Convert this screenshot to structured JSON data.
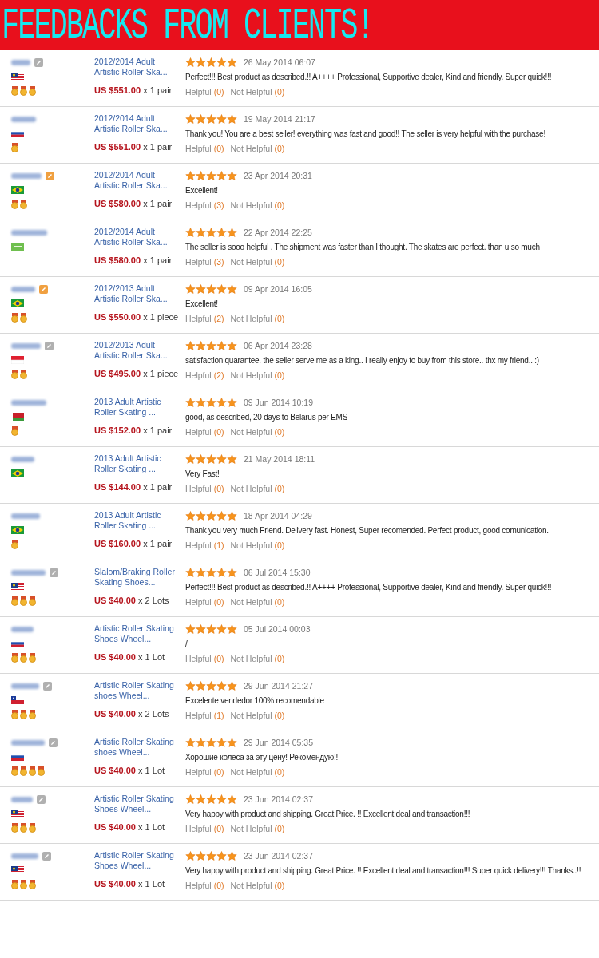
{
  "header": {
    "title": "FEEDBACKS FROM CLIENTS!"
  },
  "reviews": [
    {
      "badge": {
        "color": "#b0b0b0"
      },
      "flag": {
        "kind": "my"
      },
      "medals": [
        {
          "kind": "medal"
        },
        {
          "kind": "medal"
        },
        {
          "kind": "medal"
        }
      ],
      "product": "2012/2014 Adult Artistic Roller Ska...",
      "price": "US $551.00",
      "quantity": "x 1 pair",
      "stars": 5,
      "date": "26 May 2014 06:07",
      "comment": "Perfect!!! Best product as described.!! A++++ Professional, Supportive dealer, Kind and friendly. Super quick!!!",
      "helpful": {
        "label": "Helpful",
        "count": "(0)"
      },
      "not_helpful": {
        "label": "Not Helpful",
        "count": "(0)"
      }
    },
    {
      "flag": {
        "kind": "ru"
      },
      "medals": [
        {
          "kind": "medal"
        }
      ],
      "product": "2012/2014 Adult Artistic Roller Ska...",
      "price": "US $551.00",
      "quantity": "x 1 pair",
      "stars": 5,
      "date": "19 May 2014 21:17",
      "comment": "Thank you! You are a best seller! everything was fast and good!! The seller is very helpful with the purchase!",
      "helpful": {
        "label": "Helpful",
        "count": "(0)"
      },
      "not_helpful": {
        "label": "Not Helpful",
        "count": "(0)"
      }
    },
    {
      "badge": {
        "color": "#f0a040"
      },
      "flag": {
        "kind": "br"
      },
      "medals": [
        {
          "kind": "medal"
        },
        {
          "kind": "medal"
        }
      ],
      "product": "2012/2014 Adult Artistic Roller Ska...",
      "price": "US $580.00",
      "quantity": "x 1 pair",
      "stars": 5,
      "date": "23 Apr 2014 20:31",
      "comment": "Excellent!",
      "helpful": {
        "label": "Helpful",
        "count": "(3)"
      },
      "not_helpful": {
        "label": "Not Helpful",
        "count": "(0)"
      }
    },
    {
      "flag": {
        "kind": "sa"
      },
      "product": "2012/2014 Adult Artistic Roller Ska...",
      "price": "US $580.00",
      "quantity": "x 1 pair",
      "stars": 5,
      "date": "22 Apr 2014 22:25",
      "comment": "The seller is sooo helpful . The shipment was faster than I thought. The skates are perfect. than u so much",
      "helpful": {
        "label": "Helpful",
        "count": "(3)"
      },
      "not_helpful": {
        "label": "Not Helpful",
        "count": "(0)"
      }
    },
    {
      "badge": {
        "color": "#f0a040"
      },
      "flag": {
        "kind": "br"
      },
      "medals": [
        {
          "kind": "medal"
        },
        {
          "kind": "medal"
        }
      ],
      "product": "2012/2013 Adult Artistic Roller Ska...",
      "price": "US $550.00",
      "quantity": "x 1 piece",
      "stars": 5,
      "date": "09 Apr 2014 16:05",
      "comment": "Excellent!",
      "helpful": {
        "label": "Helpful",
        "count": "(2)"
      },
      "not_helpful": {
        "label": "Not Helpful",
        "count": "(0)"
      }
    },
    {
      "badge": {
        "color": "#b0b0b0"
      },
      "flag": {
        "kind": "id"
      },
      "medals": [
        {
          "kind": "medal"
        },
        {
          "kind": "medal"
        }
      ],
      "product": "2012/2013 Adult Artistic Roller Ska...",
      "price": "US $495.00",
      "quantity": "x 1 piece",
      "stars": 5,
      "date": "06 Apr 2014 23:28",
      "comment": "satisfaction quarantee. the seller serve me as a king.. I really enjoy to buy from this store.. thx my friend.. :)",
      "helpful": {
        "label": "Helpful",
        "count": "(2)"
      },
      "not_helpful": {
        "label": "Not Helpful",
        "count": "(0)"
      }
    },
    {
      "flag": {
        "kind": "by"
      },
      "medals": [
        {
          "kind": "medal"
        }
      ],
      "product": "2013 Adult Artistic Roller Skating ...",
      "price": "US $152.00",
      "quantity": "x 1 pair",
      "stars": 5,
      "date": "09 Jun 2014 10:19",
      "comment": "good, as described, 20 days to Belarus per EMS",
      "helpful": {
        "label": "Helpful",
        "count": "(0)"
      },
      "not_helpful": {
        "label": "Not Helpful",
        "count": "(0)"
      }
    },
    {
      "flag": {
        "kind": "br"
      },
      "product": "2013 Adult Artistic Roller Skating ...",
      "price": "US $144.00",
      "quantity": "x 1 pair",
      "stars": 5,
      "date": "21 May 2014 18:11",
      "comment": "Very Fast!",
      "helpful": {
        "label": "Helpful",
        "count": "(0)"
      },
      "not_helpful": {
        "label": "Not Helpful",
        "count": "(0)"
      }
    },
    {
      "flag": {
        "kind": "br"
      },
      "medals": [
        {
          "kind": "medal"
        }
      ],
      "product": "2013 Adult Artistic Roller Skating ...",
      "price": "US $160.00",
      "quantity": "x 1 pair",
      "stars": 5,
      "date": "18 Apr 2014 04:29",
      "comment": "Thank you very much Friend. Delivery fast. Honest, Super recomended. Perfect product, good comunication.",
      "helpful": {
        "label": "Helpful",
        "count": "(1)"
      },
      "not_helpful": {
        "label": "Not Helpful",
        "count": "(0)"
      }
    },
    {
      "badge": {
        "color": "#b0b0b0"
      },
      "flag": {
        "kind": "my"
      },
      "medals": [
        {
          "kind": "medal"
        },
        {
          "kind": "medal"
        },
        {
          "kind": "medal"
        }
      ],
      "product": "Slalom/Braking Roller Skating Shoes...",
      "price": "US $40.00",
      "quantity": "x 2 Lots",
      "stars": 5,
      "date": "06 Jul 2014 15:30",
      "comment": "Perfect!!! Best product as described.!! A++++ Professional, Supportive dealer, Kind and friendly. Super quick!!!",
      "helpful": {
        "label": "Helpful",
        "count": "(0)"
      },
      "not_helpful": {
        "label": "Not Helpful",
        "count": "(0)"
      }
    },
    {
      "flag": {
        "kind": "ru"
      },
      "medals": [
        {
          "kind": "medal"
        },
        {
          "kind": "medal"
        },
        {
          "kind": "medal"
        }
      ],
      "product": "Artistic Roller Skating Shoes Wheel...",
      "price": "US $40.00",
      "quantity": "x 1 Lot",
      "stars": 5,
      "date": "05 Jul 2014 00:03",
      "comment": "/",
      "helpful": {
        "label": "Helpful",
        "count": "(0)"
      },
      "not_helpful": {
        "label": "Not Helpful",
        "count": "(0)"
      }
    },
    {
      "badge": {
        "color": "#b0b0b0"
      },
      "flag": {
        "kind": "cl"
      },
      "medals": [
        {
          "kind": "medal"
        },
        {
          "kind": "medal"
        },
        {
          "kind": "medal"
        }
      ],
      "product": "Artistic Roller Skating shoes Wheel...",
      "price": "US $40.00",
      "quantity": "x 2 Lots",
      "stars": 5,
      "date": "29 Jun 2014 21:27",
      "comment": "Excelente vendedor 100% recomendable",
      "helpful": {
        "label": "Helpful",
        "count": "(1)"
      },
      "not_helpful": {
        "label": "Not Helpful",
        "count": "(0)"
      }
    },
    {
      "badge": {
        "color": "#b0b0b0"
      },
      "flag": {
        "kind": "ru"
      },
      "medals": [
        {
          "kind": "medal"
        },
        {
          "kind": "medal"
        },
        {
          "kind": "medal"
        },
        {
          "kind": "medal"
        }
      ],
      "product": "Artistic Roller Skating shoes Wheel...",
      "price": "US $40.00",
      "quantity": "x 1 Lot",
      "stars": 5,
      "date": "29 Jun 2014 05:35",
      "comment": "Хорошие колеса за эту цену! Рекомендую!!",
      "helpful": {
        "label": "Helpful",
        "count": "(0)"
      },
      "not_helpful": {
        "label": "Not Helpful",
        "count": "(0)"
      }
    },
    {
      "badge": {
        "color": "#b0b0b0"
      },
      "flag": {
        "kind": "my"
      },
      "medals": [
        {
          "kind": "medal"
        },
        {
          "kind": "medal"
        },
        {
          "kind": "medal"
        }
      ],
      "product": "Artistic Roller Skating Shoes Wheel...",
      "price": "US $40.00",
      "quantity": "x 1 Lot",
      "stars": 5,
      "date": "23 Jun 2014 02:37",
      "comment": "Very happy with product and shipping. Great Price. !! Excellent deal and transaction!!!",
      "helpful": {
        "label": "Helpful",
        "count": "(0)"
      },
      "not_helpful": {
        "label": "Not Helpful",
        "count": "(0)"
      }
    },
    {
      "badge": {
        "color": "#b0b0b0"
      },
      "flag": {
        "kind": "my"
      },
      "medals": [
        {
          "kind": "medal"
        },
        {
          "kind": "medal"
        },
        {
          "kind": "medal"
        }
      ],
      "product": "Artistic Roller Skating Shoes Wheel...",
      "price": "US $40.00",
      "quantity": "x 1 Lot",
      "stars": 5,
      "date": "23 Jun 2014 02:37",
      "comment": "Very happy with product and shipping. Great Price. !! Excellent deal and transaction!!! Super quick delivery!!! Thanks..!!",
      "helpful": {
        "label": "Helpful",
        "count": "(0)"
      },
      "not_helpful": {
        "label": "Not Helpful",
        "count": "(0)"
      }
    }
  ]
}
